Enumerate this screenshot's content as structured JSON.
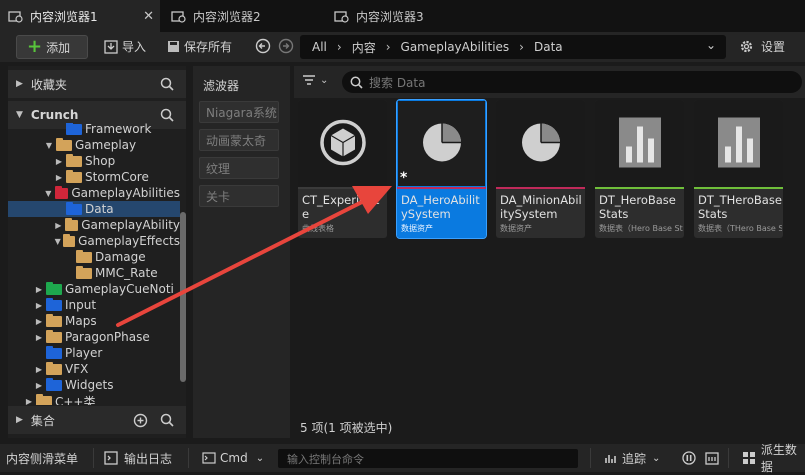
{
  "tabs": [
    {
      "label": "内容浏览器1",
      "active": true
    },
    {
      "label": "内容浏览器2",
      "active": false
    },
    {
      "label": "内容浏览器3",
      "active": false
    }
  ],
  "toolbar": {
    "add_label": "添加",
    "import_label": "导入",
    "save_all_label": "保存所有",
    "breadcrumbs": [
      "All",
      "内容",
      "GameplayAbilities",
      "Data"
    ],
    "settings_label": "设置"
  },
  "left": {
    "favorites_label": "收藏夹",
    "root_label": "Crunch",
    "collections_label": "集合",
    "tree": [
      {
        "label": "Framework",
        "depth": 2,
        "expander": "",
        "color": "#1e64d8"
      },
      {
        "label": "Gameplay",
        "depth": 1,
        "expander": "▼",
        "color": "#d3a35a"
      },
      {
        "label": "Shop",
        "depth": 2,
        "expander": "▶",
        "color": "#d3a35a"
      },
      {
        "label": "StormCore",
        "depth": 2,
        "expander": "▶",
        "color": "#d3a35a"
      },
      {
        "label": "GameplayAbilities",
        "depth": 1,
        "expander": "▼",
        "color": "#d0263a"
      },
      {
        "label": "Data",
        "depth": 2,
        "expander": "",
        "color": "#1e64d8",
        "selected": true
      },
      {
        "label": "GameplayAbility",
        "depth": 2,
        "expander": "▶",
        "color": "#d3a35a"
      },
      {
        "label": "GameplayEffects",
        "depth": 2,
        "expander": "▼",
        "color": "#d3a35a"
      },
      {
        "label": "Damage",
        "depth": 3,
        "expander": "",
        "color": "#d3a35a"
      },
      {
        "label": "MMC_Rate",
        "depth": 3,
        "expander": "",
        "color": "#d3a35a"
      },
      {
        "label": "GameplayCueNoti",
        "depth": 0,
        "expander": "▶",
        "color": "#1ea84e"
      },
      {
        "label": "Input",
        "depth": 0,
        "expander": "▶",
        "color": "#1e64d8"
      },
      {
        "label": "Maps",
        "depth": 0,
        "expander": "▶",
        "color": "#d3a35a"
      },
      {
        "label": "ParagonPhase",
        "depth": 0,
        "expander": "▶",
        "color": "#d3a35a"
      },
      {
        "label": "Player",
        "depth": 0,
        "expander": "",
        "color": "#1e64d8"
      },
      {
        "label": "VFX",
        "depth": 0,
        "expander": "▶",
        "color": "#d3a35a"
      },
      {
        "label": "Widgets",
        "depth": 0,
        "expander": "▶",
        "color": "#1e64d8"
      },
      {
        "label": "C++类",
        "depth": -1,
        "expander": "▶",
        "color": "#d3a35a"
      }
    ]
  },
  "filters": {
    "heading": "滤波器",
    "chips": [
      "Niagara系统",
      "动画蒙太奇",
      "纹理",
      "关卡"
    ]
  },
  "main": {
    "search_placeholder": "搜索 Data",
    "assets": [
      {
        "name": "CT_Experience",
        "type": "曲线表格",
        "icon": "cube-icon",
        "bar": "#3a3a3a",
        "selected": false
      },
      {
        "name": "DA_HeroAbilitySystem",
        "type": "数据资产",
        "icon": "pie-icon",
        "bar": "#c02a5a",
        "selected": true
      },
      {
        "name": "DA_MinionAbilitySystem",
        "type": "数据资产",
        "icon": "pie-icon",
        "bar": "#c02a5a",
        "selected": false
      },
      {
        "name": "DT_HeroBaseStats",
        "type": "数据表（Hero Base Stats）",
        "icon": "bar-chart-icon",
        "bar": "#6fbf3a",
        "selected": false
      },
      {
        "name": "DT_THeroBaseStats",
        "type": "数据表（THero Base Stats）",
        "icon": "bar-chart-icon",
        "bar": "#6fbf3a",
        "selected": false
      }
    ],
    "status": "5 项(1 项被选中)"
  },
  "bottom": {
    "drawer_label": "内容侧滑菜单",
    "output_log_label": "输出日志",
    "cmd_label": "Cmd",
    "cmd_placeholder": "输入控制台命令",
    "trace_label": "追踪",
    "derived_label": "派生数据"
  },
  "colors": {
    "accent": "#0a7ae0",
    "arrow": "#e8453c"
  }
}
